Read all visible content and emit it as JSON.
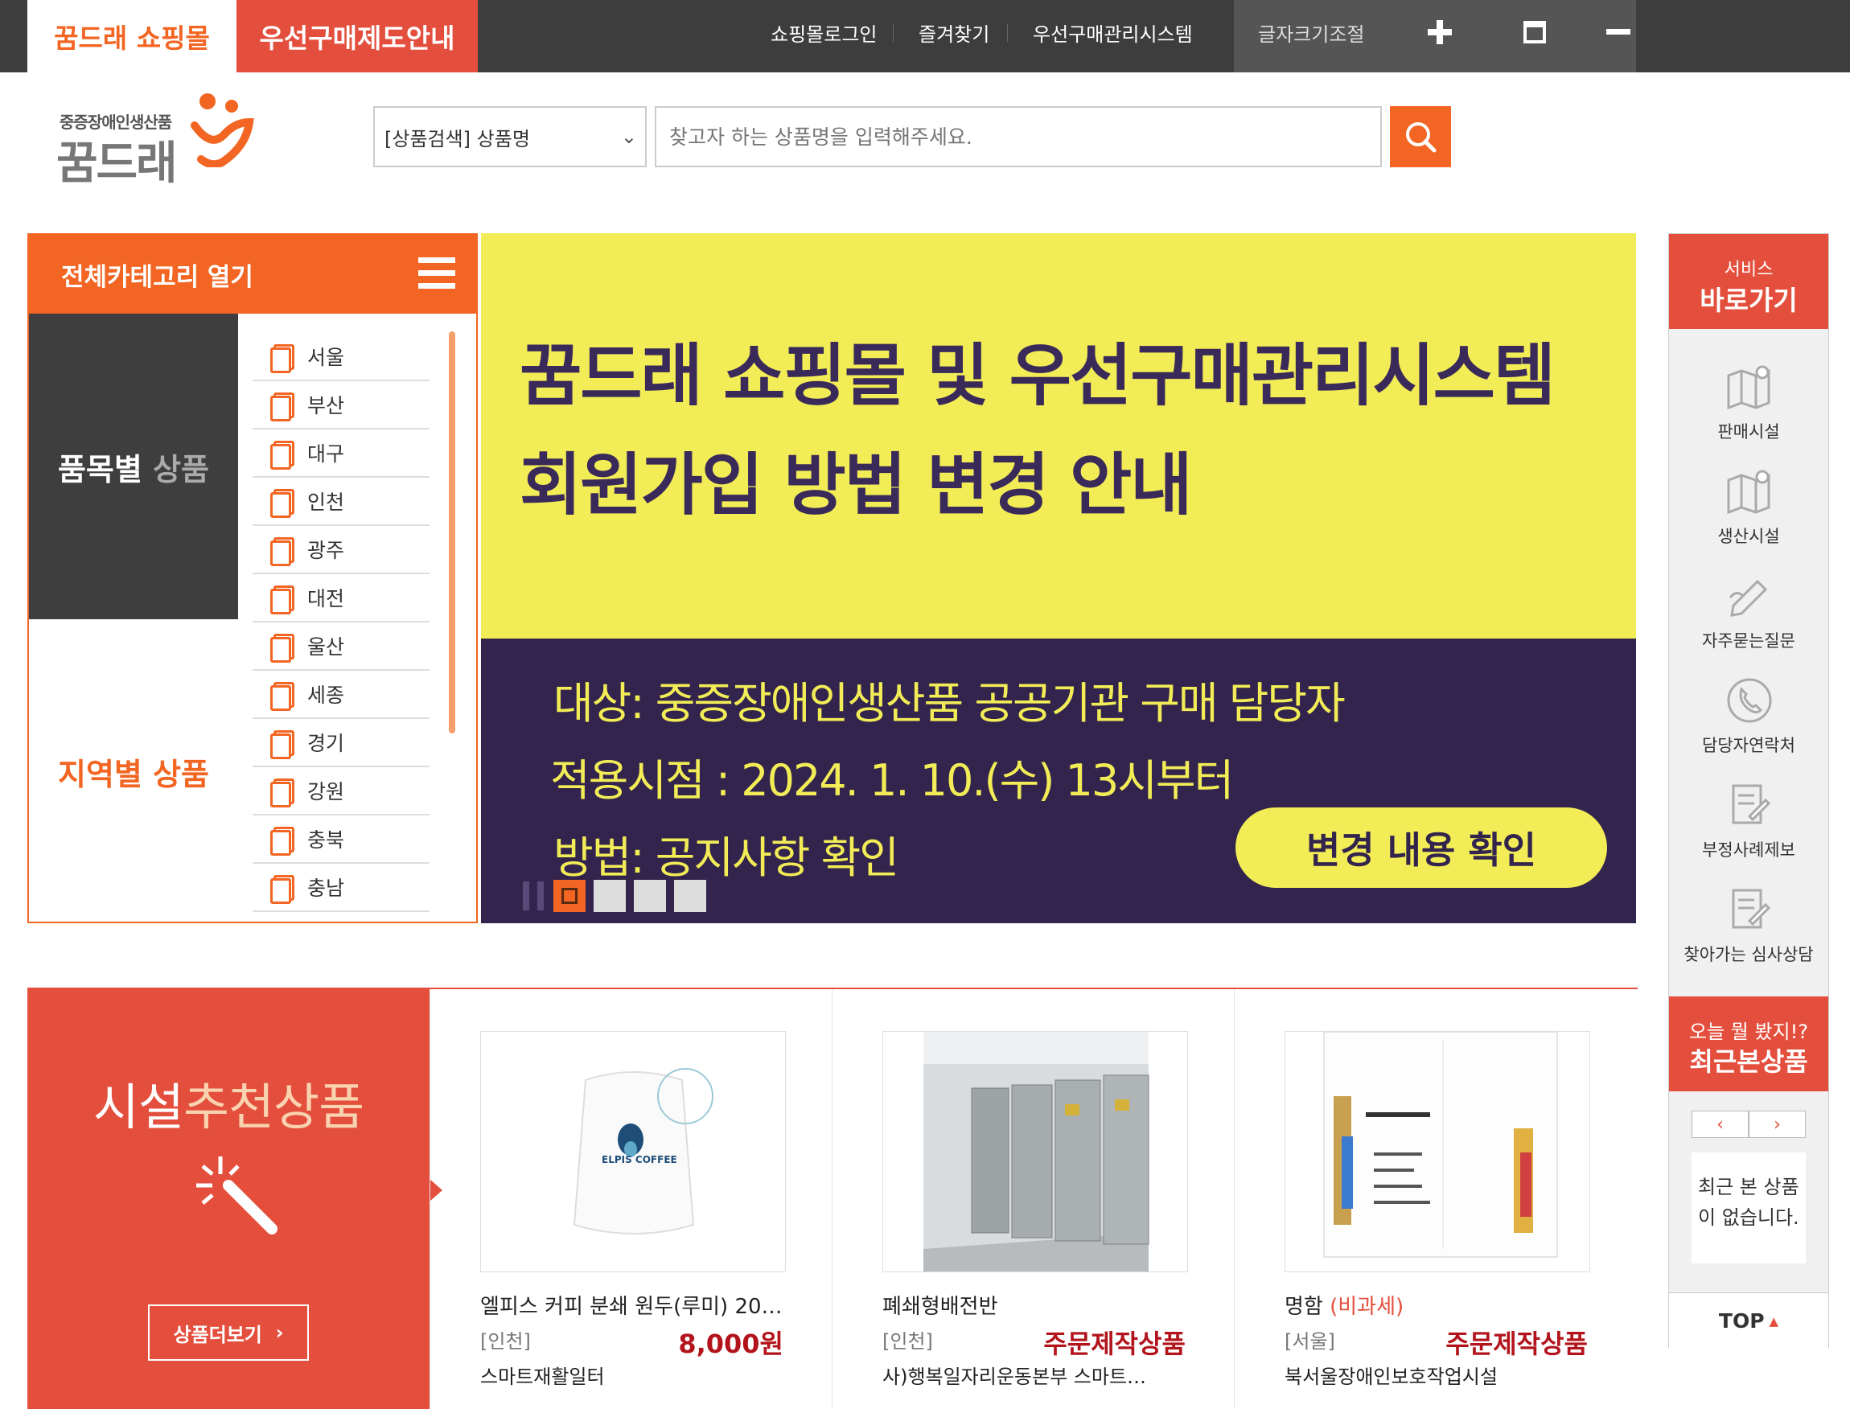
{
  "topbar": {
    "tab_shop": "꿈드래 쇼핑몰",
    "tab_pref": "우선구매제도안내",
    "links": [
      "쇼핑몰로그인",
      "즐겨찾기",
      "우선구매관리시스템"
    ],
    "font_size_label": "글자크기조절",
    "font_plus": "+",
    "font_reset": "□",
    "font_minus": "−"
  },
  "logo": {
    "sub": "중증장애인생산품",
    "main": "꿈드래"
  },
  "search": {
    "select_value": "[상품검색] 상품명",
    "placeholder": "찾고자 하는 상품명을 입력해주세요."
  },
  "category": {
    "header": "전체카테고리 열기",
    "by_product_bold": "품목별",
    "by_product_dim": "상품",
    "by_region": "지역별 상품",
    "regions": [
      "서울",
      "부산",
      "대구",
      "인천",
      "광주",
      "대전",
      "울산",
      "세종",
      "경기",
      "강원",
      "충북",
      "충남"
    ]
  },
  "banner": {
    "title_line1": "꿈드래 쇼핑몰 및 우선구매관리시스템",
    "title_line2": "회원가입 방법 변경 안내",
    "line1": "대상: 중증장애인생산품 공공기관 구매 담당자",
    "line2": "적용시점 : 2024. 1. 10.(수) 13시부터",
    "line3": "방법: 공지사항 확인",
    "button": "변경 내용 확인",
    "colors": {
      "top": "#f2ec56",
      "bottom": "#33244d"
    }
  },
  "quick": {
    "head_small": "서비스",
    "head_large": "바로가기",
    "items": [
      {
        "label": "판매시설",
        "icon": "map-icon"
      },
      {
        "label": "생산시설",
        "icon": "map-icon"
      },
      {
        "label": "자주묻는질문",
        "icon": "pen-icon"
      },
      {
        "label": "담당자연락처",
        "icon": "phone-icon"
      },
      {
        "label": "부정사례제보",
        "icon": "document-edit-icon"
      },
      {
        "label": "찾아가는 심사상담",
        "icon": "document-edit-icon"
      }
    ],
    "recent_small": "오늘 뭘 봤지!?",
    "recent_large": "최근본상품",
    "prev": "‹",
    "next": "›",
    "recent_empty": "최근 본 상품이 없습니다.",
    "top": "TOP"
  },
  "recommend": {
    "title_a": "시설",
    "title_b": "추천상품",
    "more": "상품더보기",
    "more_arrow": "›",
    "products": [
      {
        "name": "엘피스 커피 분쇄 원두(루미) 20…",
        "tax": "",
        "region": "[인천]",
        "price": "8,000원",
        "seller": "스마트재활일터",
        "brand": "ELPIS COFFEE"
      },
      {
        "name": "폐쇄형배전반",
        "tax": "",
        "region": "[인천]",
        "price": "주문제작상품",
        "seller": "사)행복일자리운동본부 스마트…"
      },
      {
        "name": "명함",
        "tax": "(비과세)",
        "region": "[서울]",
        "price": "주문제작상품",
        "seller": "북서울장애인보호작업시설"
      }
    ]
  },
  "accent": {
    "orange": "#f26522",
    "red": "#e44f3d",
    "dark": "#3d3d3d"
  }
}
